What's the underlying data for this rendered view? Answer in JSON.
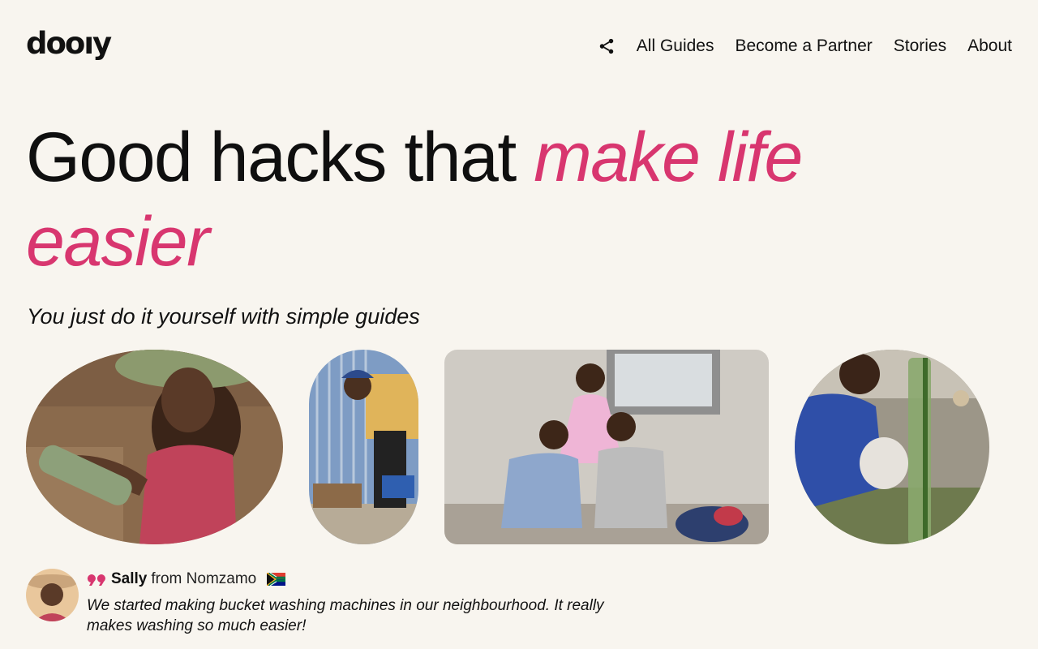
{
  "brand": {
    "logo": "dooıy"
  },
  "nav": {
    "share_icon": "share-icon",
    "items": [
      {
        "label": "All Guides"
      },
      {
        "label": "Become a Partner"
      },
      {
        "label": "Stories"
      },
      {
        "label": "About"
      }
    ]
  },
  "hero": {
    "title_plain": "Good hacks that ",
    "title_accent": "make life easier",
    "subtitle": "You just do it yourself with simple guides"
  },
  "testimonial": {
    "name": "Sally",
    "location": "from Nomzamo",
    "flag_icon": "south-africa-flag-icon",
    "quote_icon": "quote-icon",
    "quote": "We started making bucket washing machines in our neighbourhood. It really makes washing so much easier!"
  },
  "colors": {
    "background": "#f8f5ef",
    "accent": "#d8366f",
    "text": "#111111"
  }
}
